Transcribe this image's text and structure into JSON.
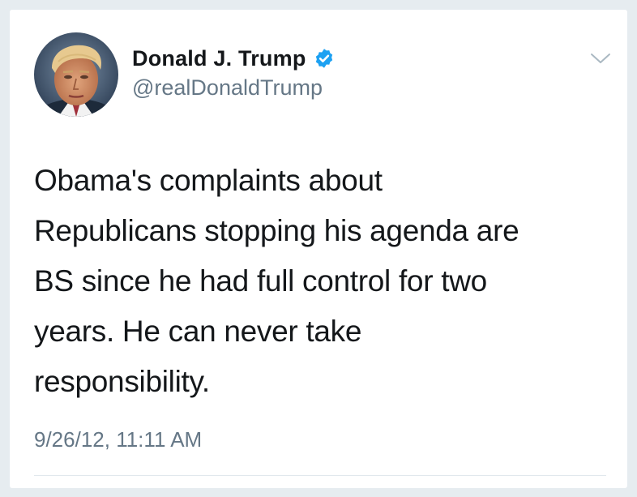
{
  "tweet": {
    "author": {
      "display_name": "Donald J. Trump",
      "handle": "@realDonaldTrump",
      "verified": true,
      "avatar_icon": "profile-photo"
    },
    "text": "Obama's complaints about\nRepublicans stopping his agenda are\nBS since he had full control for two\nyears. He can never take\nresponsibility.",
    "timestamp": "9/26/12, 11:11 AM",
    "menu_icon": "chevron-down-icon"
  },
  "colors": {
    "background": "#e6ecf0",
    "card": "#ffffff",
    "text": "#14171a",
    "secondary_text": "#657786",
    "verified_badge": "#1da1f2",
    "divider": "#e1e8ed"
  }
}
